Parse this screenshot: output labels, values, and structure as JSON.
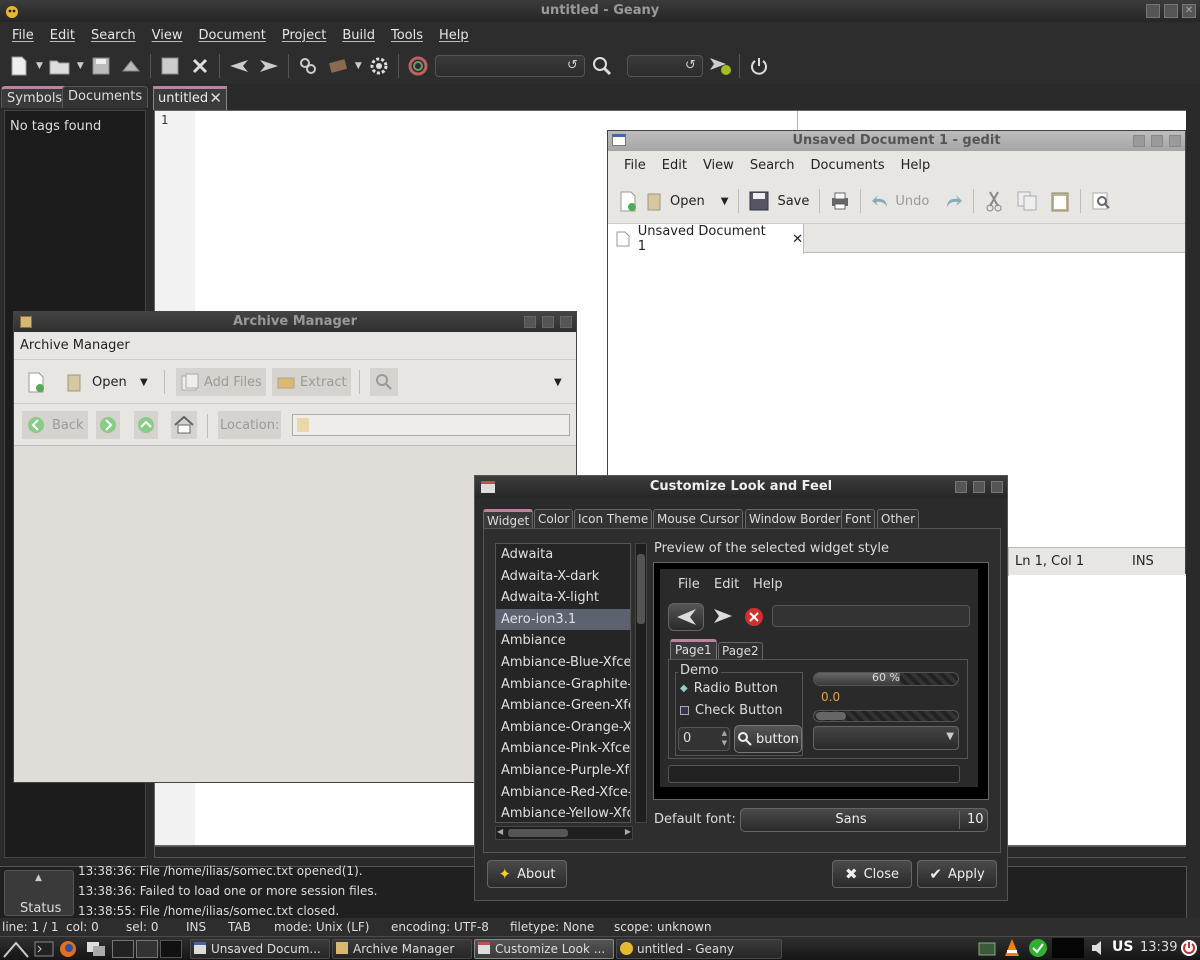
{
  "geany": {
    "title": "untitled - Geany",
    "menu": [
      "File",
      "Edit",
      "Search",
      "View",
      "Document",
      "Project",
      "Build",
      "Tools",
      "Help"
    ],
    "sidebar_tabs": [
      "Symbols",
      "Documents"
    ],
    "sidebar_text": "No tags found",
    "doc_tab": "untitled",
    "line_number": "1",
    "messages_tab": "Status",
    "messages": [
      "13:38:36: File /home/ilias/somec.txt opened(1).",
      "13:38:36: Failed to load one or more session files.",
      "13:38:55: File /home/ilias/somec.txt closed."
    ],
    "statusbar": {
      "line": "line: 1 / 1",
      "col": "col: 0",
      "sel": "sel: 0",
      "ins": "INS",
      "tab": "TAB",
      "mode": "mode: Unix (LF)",
      "encoding": "encoding: UTF-8",
      "filetype": "filetype: None",
      "scope": "scope: unknown"
    }
  },
  "gedit": {
    "title": "Unsaved Document 1 - gedit",
    "menu": [
      "File",
      "Edit",
      "View",
      "Search",
      "Documents",
      "Help"
    ],
    "toolbar": {
      "open": "Open",
      "save": "Save",
      "undo": "Undo"
    },
    "tab": "Unsaved Document 1",
    "status_pos": "Ln 1, Col 1",
    "status_mode": "INS"
  },
  "archive": {
    "title": "Archive Manager",
    "menu": "Archive Manager",
    "toolbar": {
      "open": "Open",
      "add_files": "Add Files",
      "extract": "Extract"
    },
    "nav": {
      "back": "Back",
      "location": "Location:"
    }
  },
  "clf": {
    "title": "Customize Look and Feel",
    "tabs": [
      "Widget",
      "Color",
      "Icon Theme",
      "Mouse Cursor",
      "Window Border",
      "Font",
      "Other"
    ],
    "themes": [
      "Adwaita",
      "Adwaita-X-dark",
      "Adwaita-X-light",
      "Aero-ion3.1",
      "Ambiance",
      "Ambiance-Blue-Xfce-L",
      "Ambiance-Graphite-Xf",
      "Ambiance-Green-Xfce",
      "Ambiance-Orange-Xfc",
      "Ambiance-Pink-Xfce-L",
      "Ambiance-Purple-Xfce",
      "Ambiance-Red-Xfce-LX",
      "Ambiance-Yellow-Xfce-"
    ],
    "selected_theme": "Aero-ion3.1",
    "preview_label": "Preview of the selected widget style",
    "preview": {
      "menu": [
        "File",
        "Edit",
        "Help"
      ],
      "tabs": [
        "Page1",
        "Page2"
      ],
      "demo": "Demo",
      "radio": "Radio Button",
      "check": "Check Button",
      "spin": "0",
      "button": "button",
      "progress": "60 %",
      "progress_value": 0.6,
      "scale_value": "0.0"
    },
    "default_font_label": "Default font:",
    "font_name": "Sans",
    "font_size": "10",
    "about": "About",
    "close": "Close",
    "apply": "Apply"
  },
  "taskbar": {
    "tasks": [
      "Unsaved Docum...",
      "Archive Manager",
      "Customize Look ...",
      "untitled - Geany"
    ],
    "kbd": "US",
    "clock": "13:39"
  },
  "colors": {
    "accent": "#c080a0",
    "selection": "#5c6270",
    "dark_bg": "#2b2b2b"
  }
}
